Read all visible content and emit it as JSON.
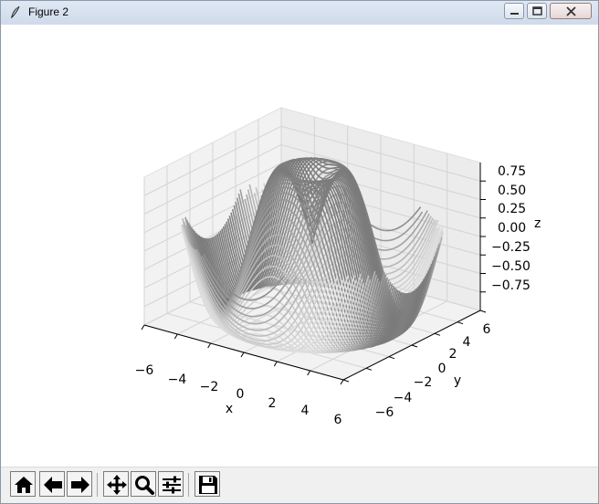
{
  "window": {
    "title": "Figure 2",
    "app_icon": "feather-icon",
    "controls": [
      "minimize-icon",
      "maximize-icon",
      "close-icon"
    ]
  },
  "toolbar": {
    "buttons": [
      {
        "name": "home-button",
        "icon": "home-icon"
      },
      {
        "name": "back-button",
        "icon": "arrow-left-icon"
      },
      {
        "name": "forward-button",
        "icon": "arrow-right-icon"
      },
      {
        "name": "pan-button",
        "icon": "move-icon"
      },
      {
        "name": "zoom-button",
        "icon": "magnifier-icon"
      },
      {
        "name": "configure-subplots-button",
        "icon": "sliders-icon"
      },
      {
        "name": "save-button",
        "icon": "floppy-disk-icon"
      }
    ]
  },
  "chart_data": {
    "type": "3d-contour",
    "title": "",
    "xlabel": "x",
    "ylabel": "y",
    "zlabel": "z",
    "xticks": [
      "−6",
      "−4",
      "−2",
      "0",
      "2",
      "4",
      "6"
    ],
    "yticks": [
      "−6",
      "−4",
      "−2",
      "0",
      "2",
      "4",
      "6"
    ],
    "zticks": [
      "0.75",
      "0.50",
      "0.25",
      "0.00",
      "−0.25",
      "−0.50",
      "−0.75"
    ],
    "xlim": [
      -6,
      6
    ],
    "ylim": [
      -6,
      6
    ],
    "zlim": [
      -1,
      1
    ],
    "grid": true,
    "colormap": "binary",
    "colors": {
      "low": "#ffffff",
      "high": "#000000"
    }
  }
}
